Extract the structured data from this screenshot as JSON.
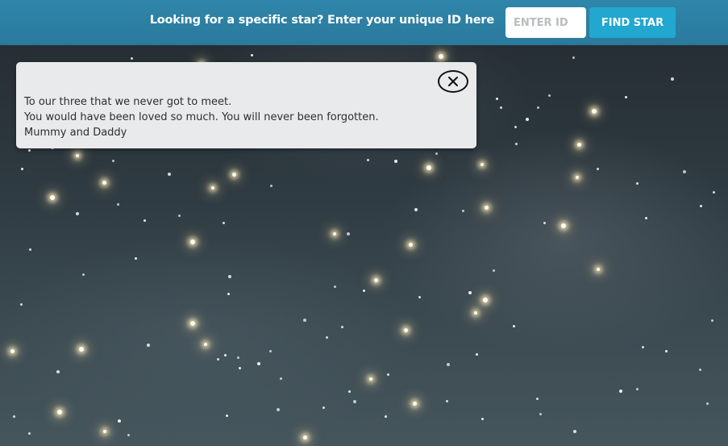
{
  "header": {
    "prompt": "Looking for a specific star? Enter your unique ID here",
    "id_input_placeholder": "ENTER ID",
    "id_input_value": "",
    "find_button_label": "FIND STAR"
  },
  "popup": {
    "message_lines": [
      "To our three that we never got to meet.",
      "You would have been loved so much. You will never been forgotten.",
      "Mummy and Daddy"
    ]
  },
  "colors": {
    "header_background": "#2f86aa",
    "button_accent": "#22a7cf",
    "sky_dark": "#242b30",
    "popup_background": "#e9eaeb"
  },
  "icons": {
    "close": "close-circle-icon"
  }
}
